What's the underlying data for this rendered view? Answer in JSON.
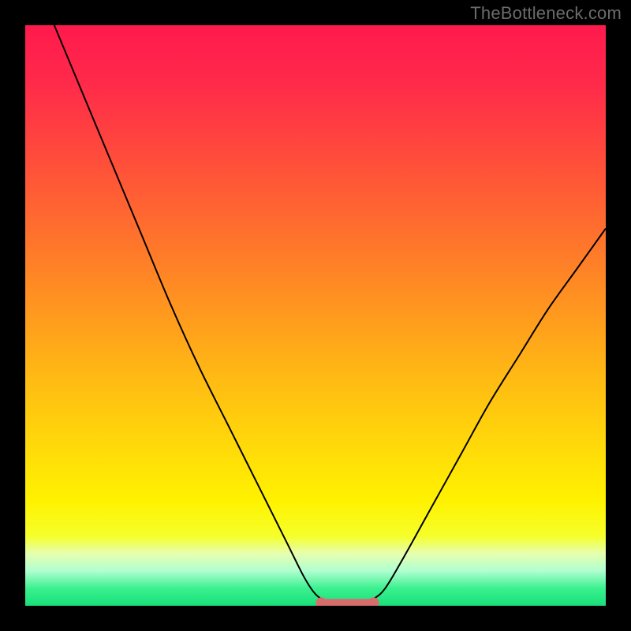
{
  "watermark": "TheBottleneck.com",
  "colors": {
    "frame": "#000000",
    "gradient_stops": [
      {
        "offset": 0.0,
        "color": "#ff1a4d"
      },
      {
        "offset": 0.1,
        "color": "#ff2a4a"
      },
      {
        "offset": 0.22,
        "color": "#ff4a3c"
      },
      {
        "offset": 0.35,
        "color": "#ff6e2e"
      },
      {
        "offset": 0.48,
        "color": "#ff9420"
      },
      {
        "offset": 0.6,
        "color": "#ffb814"
      },
      {
        "offset": 0.72,
        "color": "#ffd80a"
      },
      {
        "offset": 0.82,
        "color": "#fff200"
      },
      {
        "offset": 0.88,
        "color": "#f6ff2a"
      },
      {
        "offset": 0.91,
        "color": "#e6ffb0"
      },
      {
        "offset": 0.94,
        "color": "#b0ffd0"
      },
      {
        "offset": 0.97,
        "color": "#3bf08f"
      },
      {
        "offset": 1.0,
        "color": "#19e07a"
      }
    ],
    "curve": "#000000",
    "accent_segment": "#d86b6b",
    "accent_point": "#d86b6b"
  },
  "chart_data": {
    "type": "line",
    "title": "",
    "xlabel": "",
    "ylabel": "",
    "xlim": [
      0,
      100
    ],
    "ylim": [
      0,
      100
    ],
    "series": [
      {
        "name": "bottleneck-curve",
        "x": [
          5,
          10,
          15,
          20,
          25,
          30,
          35,
          40,
          45,
          48,
          50,
          52,
          54,
          56,
          58,
          60,
          62,
          65,
          70,
          75,
          80,
          85,
          90,
          95,
          100
        ],
        "y": [
          100,
          88,
          76,
          64,
          52,
          41,
          31,
          21,
          11,
          5,
          2,
          0.7,
          0.3,
          0.3,
          0.5,
          1.2,
          3,
          8,
          17,
          26,
          35,
          43,
          51,
          58,
          65
        ]
      }
    ],
    "accent_flat_region": {
      "x_start": 51,
      "x_end": 60,
      "y": 0.5
    }
  }
}
